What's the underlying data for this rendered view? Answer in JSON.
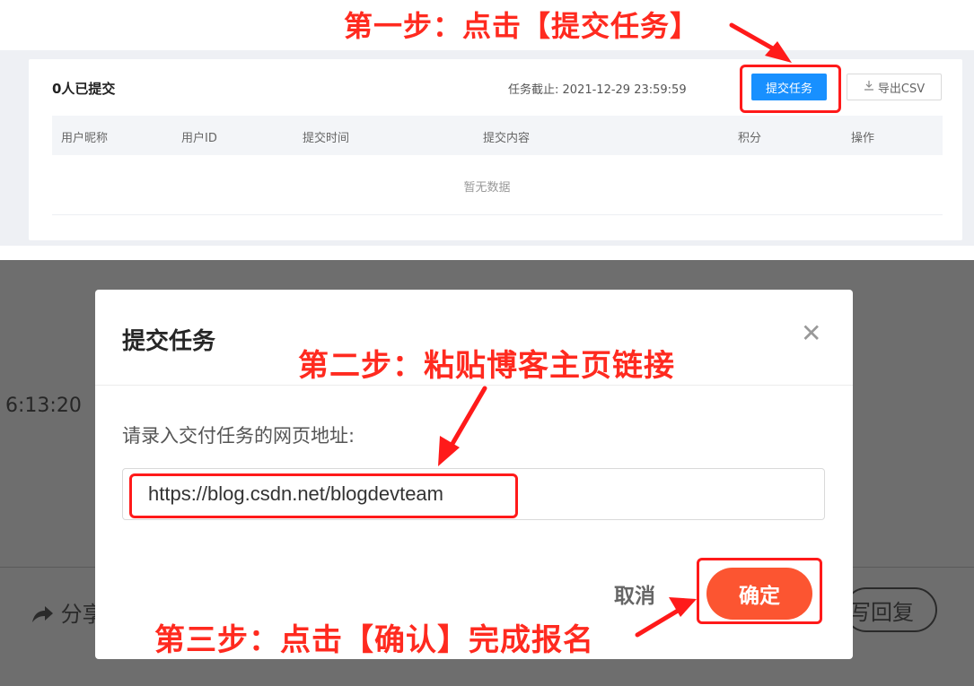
{
  "annotations": {
    "step1": "第一步：点击【提交任务】",
    "step2": "第二步：粘贴博客主页链接",
    "step3": "第三步：点击【确认】完成报名"
  },
  "task_panel": {
    "submitted_count": "0人已提交",
    "deadline_label": "任务截止:",
    "deadline_value": "2021-12-29 23:59:59",
    "submit_button": "提交任务",
    "export_button": "导出CSV",
    "export_icon": "download-icon",
    "columns": [
      "用户昵称",
      "用户ID",
      "提交时间",
      "提交内容",
      "积分",
      "操作"
    ],
    "empty_text": "暂无数据"
  },
  "background": {
    "time_fragment": "6:13:20",
    "share_fragment": "分享",
    "share_icon": "share-arrow-icon",
    "reply_fragment": "写回复"
  },
  "dialog": {
    "title": "提交任务",
    "close_icon": "close-icon",
    "field_label": "请录入交付任务的网页地址:",
    "url_value": "https://blog.csdn.net/blogdevteam",
    "cancel_label": "取消",
    "confirm_label": "确定"
  },
  "colors": {
    "annotation_red": "#ff2a1f",
    "primary_blue": "#1890ff",
    "confirm_orange": "#fc5531",
    "overlay_gray": "#6e6e6e"
  }
}
